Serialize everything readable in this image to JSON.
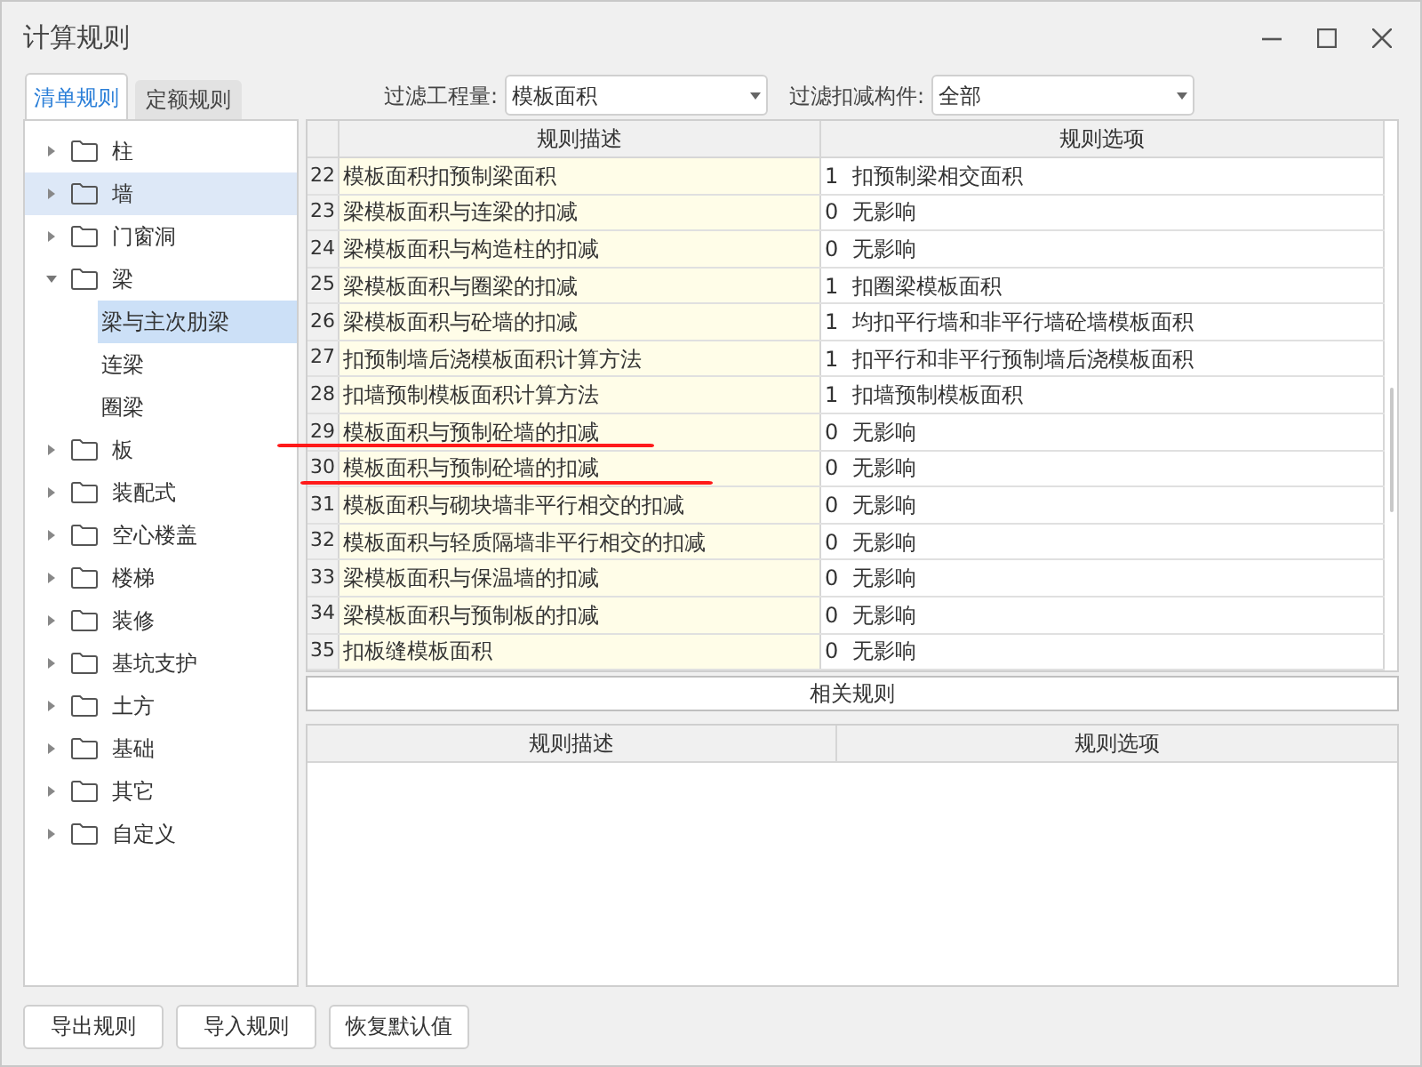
{
  "window": {
    "title": "计算规则"
  },
  "tabs": [
    {
      "label": "清单规则",
      "selected": true
    },
    {
      "label": "定额规则",
      "selected": false
    }
  ],
  "filters": [
    {
      "label": "过滤工程量:",
      "value": "模板面积"
    },
    {
      "label": "过滤扣减构件:",
      "value": "全部"
    }
  ],
  "tree": [
    {
      "label": "柱",
      "expanded": false,
      "hovered": false
    },
    {
      "label": "墙",
      "expanded": false,
      "hovered": true
    },
    {
      "label": "门窗洞",
      "expanded": false,
      "hovered": false
    },
    {
      "label": "梁",
      "expanded": true,
      "hovered": false,
      "children": [
        {
          "label": "梁与主次肋梁",
          "selected": true
        },
        {
          "label": "连梁",
          "selected": false
        },
        {
          "label": "圈梁",
          "selected": false
        }
      ]
    },
    {
      "label": "板",
      "expanded": false,
      "hovered": false
    },
    {
      "label": "装配式",
      "expanded": false,
      "hovered": false
    },
    {
      "label": "空心楼盖",
      "expanded": false,
      "hovered": false
    },
    {
      "label": "楼梯",
      "expanded": false,
      "hovered": false
    },
    {
      "label": "装修",
      "expanded": false,
      "hovered": false
    },
    {
      "label": "基坑支护",
      "expanded": false,
      "hovered": false
    },
    {
      "label": "土方",
      "expanded": false,
      "hovered": false
    },
    {
      "label": "基础",
      "expanded": false,
      "hovered": false
    },
    {
      "label": "其它",
      "expanded": false,
      "hovered": false
    },
    {
      "label": "自定义",
      "expanded": false,
      "hovered": false
    }
  ],
  "table": {
    "columns": [
      "规则描述",
      "规则选项"
    ],
    "rows": [
      {
        "num": "22",
        "desc": "模板面积扣预制梁面积",
        "code": "1",
        "option": "扣预制梁相交面积",
        "underlined": false
      },
      {
        "num": "23",
        "desc": "梁模板面积与连梁的扣减",
        "code": "0",
        "option": "无影响",
        "underlined": false
      },
      {
        "num": "24",
        "desc": "梁模板面积与构造柱的扣减",
        "code": "0",
        "option": "无影响",
        "underlined": false
      },
      {
        "num": "25",
        "desc": "梁模板面积与圈梁的扣减",
        "code": "1",
        "option": "扣圈梁模板面积",
        "underlined": false
      },
      {
        "num": "26",
        "desc": "梁模板面积与砼墙的扣减",
        "code": "1",
        "option": "均扣平行墙和非平行墙砼墙模板面积",
        "underlined": false
      },
      {
        "num": "27",
        "desc": "扣预制墙后浇模板面积计算方法",
        "code": "1",
        "option": "扣平行和非平行预制墙后浇模板面积",
        "underlined": false
      },
      {
        "num": "28",
        "desc": "扣墙预制模板面积计算方法",
        "code": "1",
        "option": "扣墙预制模板面积",
        "underlined": false
      },
      {
        "num": "29",
        "desc": "模板面积与预制砼墙的扣减",
        "code": "0",
        "option": "无影响",
        "underlined": true
      },
      {
        "num": "30",
        "desc": "模板面积与预制砼墙的扣减",
        "code": "0",
        "option": "无影响",
        "underlined": true
      },
      {
        "num": "31",
        "desc": "模板面积与砌块墙非平行相交的扣减",
        "code": "0",
        "option": "无影响",
        "underlined": false
      },
      {
        "num": "32",
        "desc": "模板面积与轻质隔墙非平行相交的扣减",
        "code": "0",
        "option": "无影响",
        "underlined": false
      },
      {
        "num": "33",
        "desc": "梁模板面积与保温墙的扣减",
        "code": "0",
        "option": "无影响",
        "underlined": false
      },
      {
        "num": "34",
        "desc": "梁模板面积与预制板的扣减",
        "code": "0",
        "option": "无影响",
        "underlined": false
      },
      {
        "num": "35",
        "desc": "扣板缝模板面积",
        "code": "0",
        "option": "无影响",
        "underlined": false
      }
    ]
  },
  "related": {
    "title": "相关规则",
    "columns": [
      "规则描述",
      "规则选项"
    ]
  },
  "buttons": [
    "导出规则",
    "导入规则",
    "恢复默认值"
  ]
}
